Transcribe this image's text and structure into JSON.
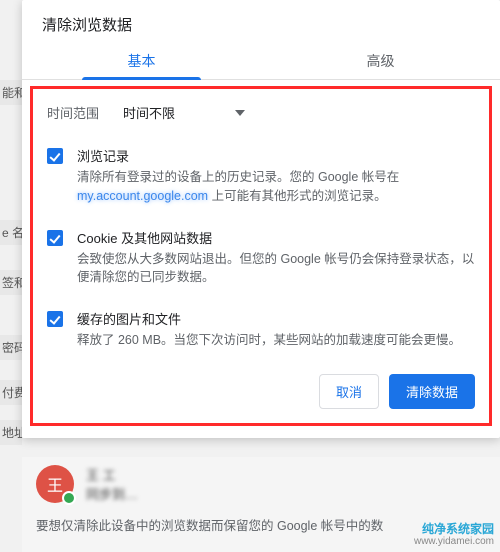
{
  "dialog": {
    "title": "清除浏览数据",
    "tabs": {
      "basic": "基本",
      "advanced": "高级"
    },
    "time_range_label": "时间范围",
    "time_range_value": "时间不限",
    "options": {
      "history": {
        "title": "浏览记录",
        "desc_a": "清除所有登录过的设备上的历史记录。您的 Google 帐号在",
        "link": "my.account.google.com",
        "desc_b": " 上可能有其他形式的浏览记录。"
      },
      "cookies": {
        "title": "Cookie 及其他网站数据",
        "desc": "会致使您从大多数网站退出。但您的 Google 帐号仍会保持登录状态，以便清除您的已同步数据。"
      },
      "cache": {
        "title": "缓存的图片和文件",
        "desc": "释放了 260 MB。当您下次访问时，某些网站的加载速度可能会更慢。"
      }
    },
    "buttons": {
      "cancel": "取消",
      "clear": "清除数据"
    }
  },
  "footer": {
    "avatar_letter": "王",
    "name_blur": "王 工",
    "sync_blur": "同步到…",
    "note": "要想仅清除此设备中的浏览数据而保留您的 Google 帐号中的数"
  },
  "sidebar_hints": [
    "能和",
    "e 名",
    "签和",
    "密码",
    "付费",
    "地址"
  ],
  "watermark": {
    "line1": "纯净系统家园",
    "line2": "www.yidamei.com"
  }
}
